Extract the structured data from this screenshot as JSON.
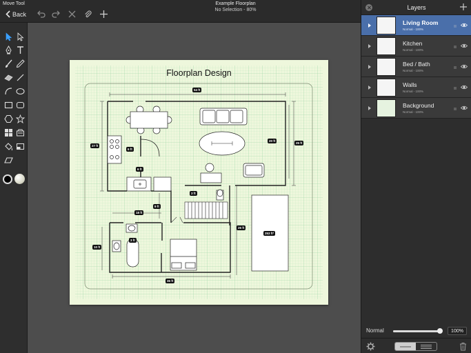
{
  "header": {
    "tool_name": "Move Tool",
    "back_label": "Back",
    "doc_title": "Example Floorplan",
    "doc_status": "No Selection - 80%"
  },
  "toolbar": {
    "tools": [
      "select-arrow-icon",
      "direct-select-icon",
      "pen-tool-icon",
      "text-tool-icon",
      "brush-icon",
      "pencil-icon",
      "eraser-icon",
      "line-icon",
      "arc-icon",
      "ellipse-icon",
      "rectangle-icon",
      "rounded-rect-icon",
      "hexagon-icon",
      "star-icon",
      "grid-icon",
      "stamp-icon",
      "fill-icon",
      "image-icon",
      "shear-icon"
    ],
    "stroke_color": "#000000",
    "fill_color": "#e8e8e0"
  },
  "drawing": {
    "title": "Floorplan Design",
    "dimensions": {
      "top_width": "54 ft",
      "left_height": "27 ft",
      "right_inner": "20 ft",
      "right_outer": "25 ft",
      "kitchen_a": "6 ft",
      "kitchen_b": "6 ft",
      "stairs": "3 ft",
      "hall_w": "18 ft",
      "hall_h": "9 ft",
      "bath_h": "10 ft",
      "bath_w": "3 ft",
      "bottom_width": "36 ft",
      "mid_height": "26 ft",
      "area": "253 ft²"
    }
  },
  "layers_panel": {
    "title": "Layers",
    "layers": [
      {
        "name": "Living Room",
        "sub": "Normal - 100%",
        "selected": true
      },
      {
        "name": "Kitchen",
        "sub": "Normal - 100%",
        "selected": false
      },
      {
        "name": "Bed / Bath",
        "sub": "Normal - 100%",
        "selected": false
      },
      {
        "name": "Walls",
        "sub": "Normal - 100%",
        "selected": false
      },
      {
        "name": "Background",
        "sub": "Normal - 100%",
        "selected": false
      }
    ],
    "blend_mode": "Normal",
    "opacity": "100%",
    "opacity_fraction": 1.0
  },
  "colors": {
    "accent": "#3aa0ff",
    "selected_layer": "#4a6faa",
    "paper": "#eef7dc",
    "grid": "#9fd6a8"
  }
}
